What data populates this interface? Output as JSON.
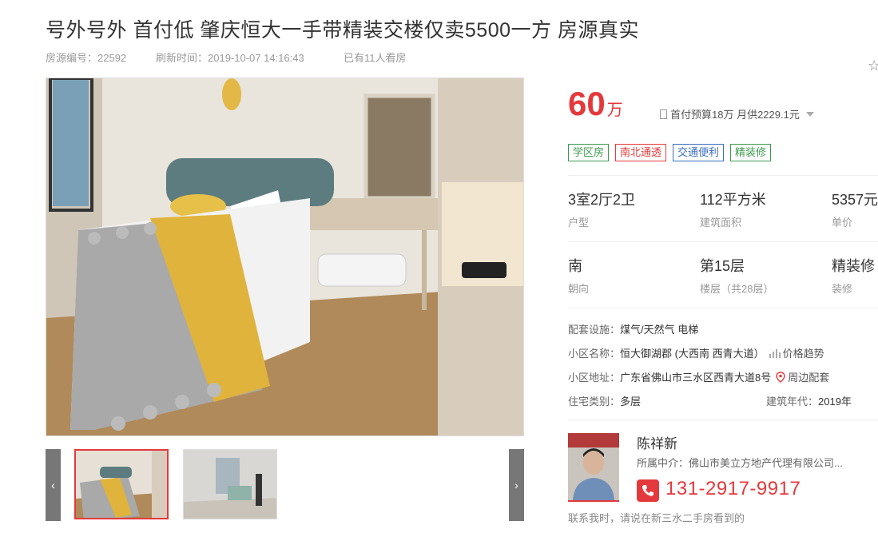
{
  "title": "号外号外 首付低 肇庆恒大一手带精装交楼仅卖5500一方 房源真实",
  "meta": {
    "listing_id": "房源编号：22592",
    "refresh_time": "刷新时间：2019-10-07 14:16:43",
    "views": "已有11人看房"
  },
  "price": {
    "amount": "60",
    "unit": "万",
    "budget": "首付预算18万 月供2229.1元"
  },
  "tags": [
    {
      "label": "学区房",
      "color": "#3d9a4f"
    },
    {
      "label": "南北通透",
      "color": "#e4393c"
    },
    {
      "label": "交通便利",
      "color": "#3a6fc4"
    },
    {
      "label": "精装修",
      "color": "#3d9a4f"
    }
  ],
  "stats_row1": [
    {
      "value": "3室2厅2卫",
      "label": "户型"
    },
    {
      "value": "112平方米",
      "label": "建筑面积"
    },
    {
      "value": "5357元",
      "label": "单价"
    }
  ],
  "stats_row2": [
    {
      "value": "南",
      "label": "朝向"
    },
    {
      "value": "第15层",
      "label": "楼层（共28层）"
    },
    {
      "value": "精装修",
      "label": "装修"
    }
  ],
  "details": {
    "facilities_label": "配套设施：",
    "facilities_value": "煤气/天然气 电梯",
    "community_label": "小区名称：",
    "community_value": "恒大御湖郡 (大西南 西青大道）",
    "price_trend": "价格趋势",
    "address_label": "小区地址：",
    "address_value": "广东省佛山市三水区西青大道8号",
    "nearby": "周边配套",
    "type_label": "住宅类别：",
    "type_value": "多层",
    "year_label": "建筑年代：",
    "year_value": "2019年"
  },
  "agent": {
    "name": "陈祥新",
    "agency": "所属中介：佛山市美立方地产代理有限公司...",
    "phone": "131-2917-9917",
    "note": "联系我时，请说在新三水二手房看到的"
  },
  "gallery": {
    "prev_arrow": "‹",
    "next_arrow": "›"
  }
}
